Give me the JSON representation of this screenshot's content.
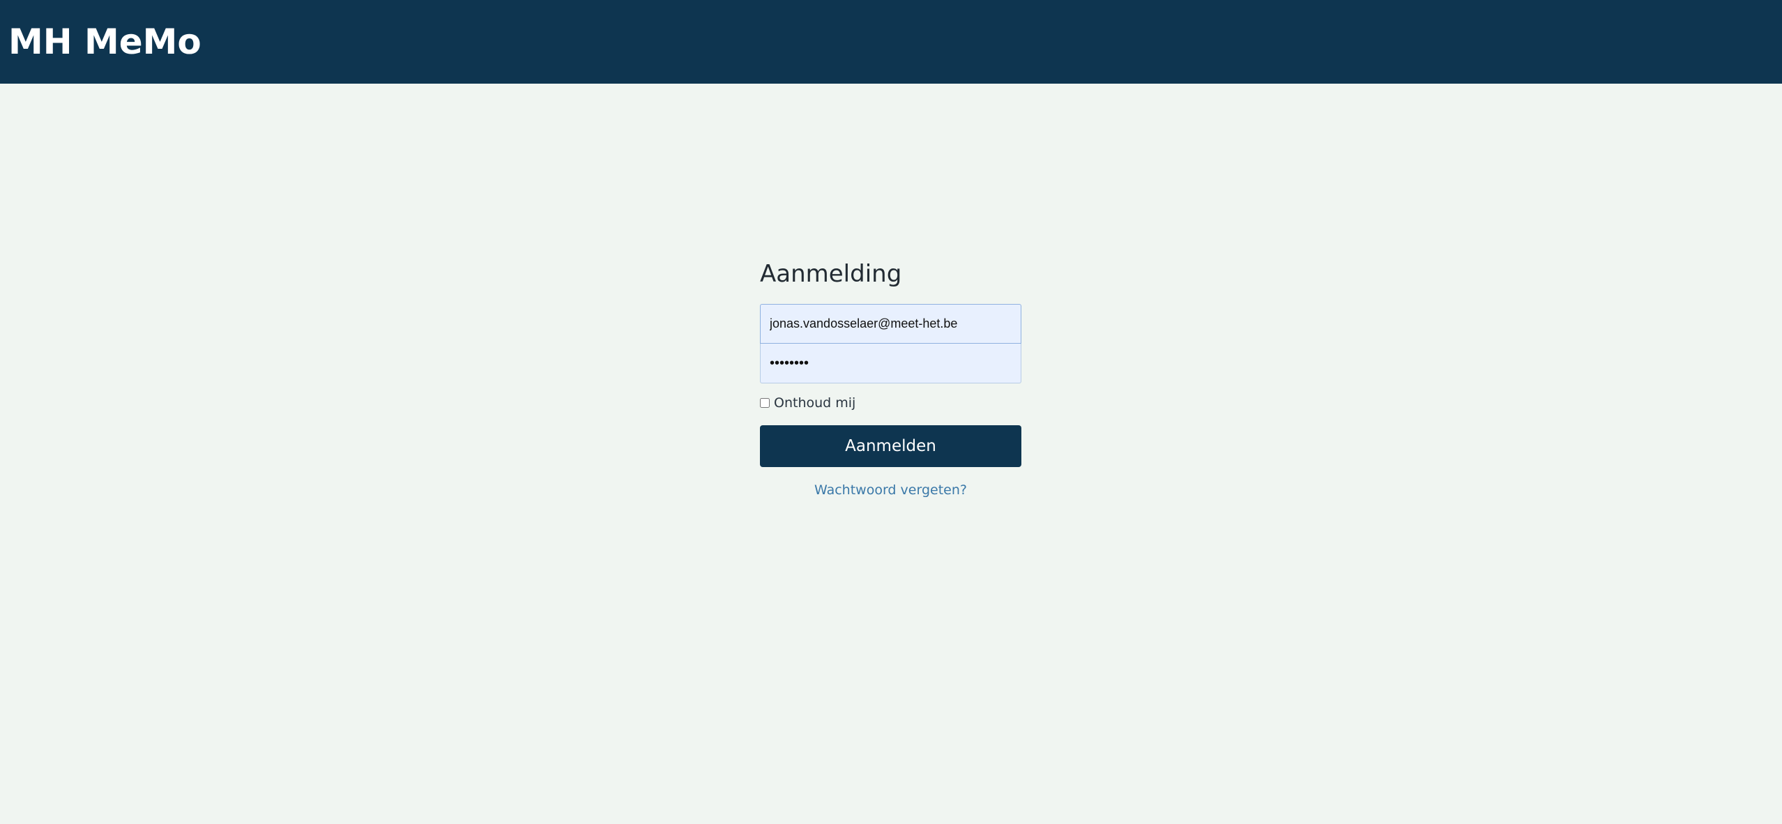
{
  "header": {
    "brand": "MH MeMo",
    "background_color": "#0e3550"
  },
  "login": {
    "title": "Aanmelding",
    "email_value": "jonas.vandosselaer@meet-het.be",
    "password_value": "••••••••",
    "remember_label": "Onthoud mij",
    "remember_checked": false,
    "submit_label": "Aanmelden",
    "forgot_label": "Wachtwoord vergeten?",
    "accent_color": "#0e3550",
    "link_color": "#3a78a8"
  }
}
